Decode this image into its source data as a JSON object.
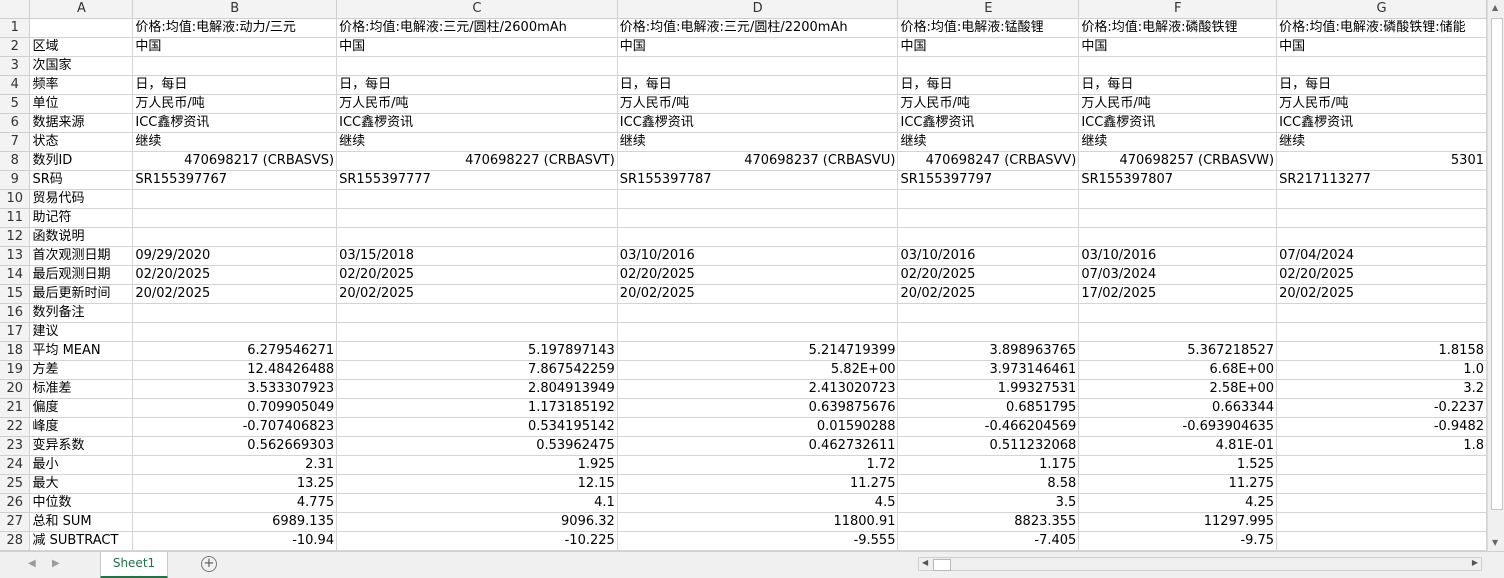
{
  "columns": [
    "A",
    "B",
    "C",
    "D",
    "E",
    "F",
    "G"
  ],
  "rows": [
    {
      "n": "1",
      "cells": [
        "",
        "价格:均值:电解液:动力/三元",
        "价格:均值:电解液:三元/圆柱/2600mAh",
        "价格:均值:电解液:三元/圆柱/2200mAh",
        "价格:均值:电解液:锰酸锂",
        "价格:均值:电解液:磷酸铁锂",
        "价格:均值:电解液:磷酸铁锂:储能"
      ]
    },
    {
      "n": "2",
      "cells": [
        "区域",
        "中国",
        "中国",
        "中国",
        "中国",
        "中国",
        "中国"
      ]
    },
    {
      "n": "3",
      "cells": [
        "次国家",
        "",
        "",
        "",
        "",
        "",
        ""
      ]
    },
    {
      "n": "4",
      "cells": [
        "频率",
        "日，每日",
        "日，每日",
        "日，每日",
        "日，每日",
        "日，每日",
        "日，每日"
      ]
    },
    {
      "n": "5",
      "cells": [
        "单位",
        "万人民币/吨",
        "万人民币/吨",
        "万人民币/吨",
        "万人民币/吨",
        "万人民币/吨",
        "万人民币/吨"
      ]
    },
    {
      "n": "6",
      "cells": [
        "数据来源",
        "ICC鑫椤资讯",
        "ICC鑫椤资讯",
        "ICC鑫椤资讯",
        "ICC鑫椤资讯",
        "ICC鑫椤资讯",
        "ICC鑫椤资讯"
      ]
    },
    {
      "n": "7",
      "cells": [
        "状态",
        "继续",
        "继续",
        "继续",
        "继续",
        "继续",
        "继续"
      ]
    },
    {
      "n": "8",
      "cells": [
        "数列ID",
        "470698217 (CRBASVS)",
        "470698227 (CRBASVT)",
        "470698237 (CRBASVU)",
        "470698247 (CRBASVV)",
        "470698257 (CRBASVW)",
        "5301"
      ]
    },
    {
      "n": "9",
      "cells": [
        "SR码",
        "SR155397767",
        "SR155397777",
        "SR155397787",
        "SR155397797",
        "SR155397807",
        "SR217113277"
      ]
    },
    {
      "n": "10",
      "cells": [
        "贸易代码",
        "",
        "",
        "",
        "",
        "",
        ""
      ]
    },
    {
      "n": "11",
      "cells": [
        "助记符",
        "",
        "",
        "",
        "",
        "",
        ""
      ]
    },
    {
      "n": "12",
      "cells": [
        "函数说明",
        "",
        "",
        "",
        "",
        "",
        ""
      ]
    },
    {
      "n": "13",
      "cells": [
        "首次观测日期",
        "09/29/2020",
        "03/15/2018",
        "03/10/2016",
        "03/10/2016",
        "03/10/2016",
        "07/04/2024"
      ]
    },
    {
      "n": "14",
      "cells": [
        "最后观测日期",
        "02/20/2025",
        "02/20/2025",
        "02/20/2025",
        "02/20/2025",
        "07/03/2024",
        "02/20/2025"
      ]
    },
    {
      "n": "15",
      "cells": [
        "最后更新时间",
        "20/02/2025",
        "20/02/2025",
        "20/02/2025",
        "20/02/2025",
        "17/02/2025",
        "20/02/2025"
      ]
    },
    {
      "n": "16",
      "cells": [
        "数列备注",
        "",
        "",
        "",
        "",
        "",
        ""
      ]
    },
    {
      "n": "17",
      "cells": [
        "建议",
        "",
        "",
        "",
        "",
        "",
        ""
      ]
    },
    {
      "n": "18",
      "cells": [
        "平均 MEAN",
        "6.279546271",
        "5.197897143",
        "5.214719399",
        "3.898963765",
        "5.367218527",
        "1.8158"
      ]
    },
    {
      "n": "19",
      "cells": [
        "方差",
        "12.48426488",
        "7.867542259",
        "5.82E+00",
        "3.973146461",
        "6.68E+00",
        "1.0"
      ]
    },
    {
      "n": "20",
      "cells": [
        "标准差",
        "3.533307923",
        "2.804913949",
        "2.413020723",
        "1.99327531",
        "2.58E+00",
        "3.2"
      ]
    },
    {
      "n": "21",
      "cells": [
        "偏度",
        "0.709905049",
        "1.173185192",
        "0.639875676",
        "0.6851795",
        "0.663344",
        "-0.2237"
      ]
    },
    {
      "n": "22",
      "cells": [
        "峰度",
        "-0.707406823",
        "0.534195142",
        "0.01590288",
        "-0.466204569",
        "-0.693904635",
        "-0.9482"
      ]
    },
    {
      "n": "23",
      "cells": [
        "变异系数",
        "0.562669303",
        "0.53962475",
        "0.462732611",
        "0.511232068",
        "4.81E-01",
        "1.8"
      ]
    },
    {
      "n": "24",
      "cells": [
        "最小",
        "2.31",
        "1.925",
        "1.72",
        "1.175",
        "1.525",
        ""
      ]
    },
    {
      "n": "25",
      "cells": [
        "最大",
        "13.25",
        "12.15",
        "11.275",
        "8.58",
        "11.275",
        ""
      ]
    },
    {
      "n": "26",
      "cells": [
        "中位数",
        "4.775",
        "4.1",
        "4.5",
        "3.5",
        "4.25",
        ""
      ]
    },
    {
      "n": "27",
      "cells": [
        "总和 SUM",
        "6989.135",
        "9096.32",
        "11800.91",
        "8823.355",
        "11297.995",
        ""
      ]
    },
    {
      "n": "28",
      "cells": [
        "减 SUBTRACT",
        "-10.94",
        "-10.225",
        "-9.555",
        "-7.405",
        "-9.75",
        ""
      ]
    }
  ],
  "numeric_rows": [
    "8",
    "18",
    "19",
    "20",
    "21",
    "22",
    "23",
    "24",
    "25",
    "26",
    "27",
    "28"
  ],
  "sheet_tab": "Sheet1",
  "add_sheet_symbol": "+",
  "accent_color": "#217346"
}
